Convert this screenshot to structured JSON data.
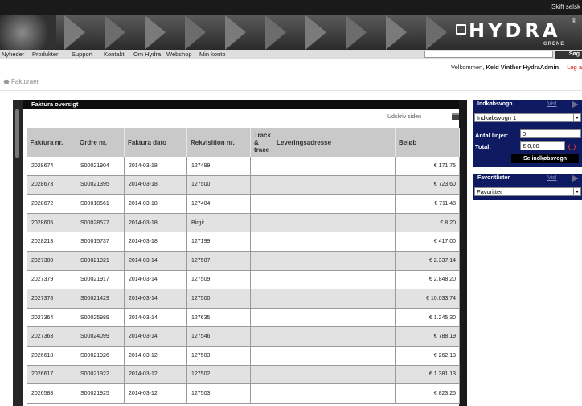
{
  "topbar": {
    "change_company": "Skift selsk"
  },
  "brand": {
    "name": "HYDRA",
    "registered": "®",
    "sub": "GRENE"
  },
  "nav": {
    "items": [
      "Nyheder",
      "Produkter",
      "Support",
      "Kontakt",
      "Om Hydra",
      "Webshop",
      "Min konto"
    ],
    "search_button": "Søg",
    "search_value": ""
  },
  "welcome": {
    "prefix": "Velkommen,",
    "user": "Keld Vinther HydraAdmin",
    "logout": "Log a"
  },
  "breadcrumb": {
    "label": "Fakturaer"
  },
  "invoices": {
    "title": "Faktura oversigt",
    "print_label": "Udskriv siden",
    "columns": [
      "Faktura nr.",
      "Ordre nr.",
      "Faktura dato",
      "Rekvisition nr.",
      "Track & trace",
      "Leveringsadresse",
      "Beløb"
    ],
    "rows": [
      [
        "2028674",
        "S00021904",
        "2014-03-18",
        "127499",
        "",
        "",
        "€ 171,75"
      ],
      [
        "2028673",
        "S00021395",
        "2014-03-18",
        "127500",
        "",
        "",
        "€ 723,60"
      ],
      [
        "2028672",
        "S00018561",
        "2014-03-18",
        "127404",
        "",
        "",
        "€ 711,48"
      ],
      [
        "2028605",
        "S00028577",
        "2014-03-18",
        "Birgit",
        "",
        "",
        "€ 8,20"
      ],
      [
        "2028213",
        "S00015737",
        "2014-03-18",
        "127199",
        "",
        "",
        "€ 417,00"
      ],
      [
        "2027380",
        "S00021921",
        "2014-03-14",
        "127507",
        "",
        "",
        "€ 2.337,14"
      ],
      [
        "2027379",
        "S00021917",
        "2014-03-14",
        "127509",
        "",
        "",
        "€ 2.848,20"
      ],
      [
        "2027378",
        "S00021429",
        "2014-03-14",
        "127500",
        "",
        "",
        "€ 10.033,74"
      ],
      [
        "2027364",
        "S00025989",
        "2014-03-14",
        "127635",
        "",
        "",
        "€ 1.245,30"
      ],
      [
        "2027363",
        "S00024099",
        "2014-03-14",
        "127546",
        "",
        "",
        "€ 788,19"
      ],
      [
        "2026618",
        "S00021926",
        "2014-03-12",
        "127503",
        "",
        "",
        "€ 262,13"
      ],
      [
        "2026617",
        "S00021922",
        "2014-03-12",
        "127502",
        "",
        "",
        "€ 1.381,13"
      ],
      [
        "2026588",
        "S00021925",
        "2014-03-12",
        "127503",
        "",
        "",
        "€ 823,25"
      ]
    ]
  },
  "cart": {
    "title": "Indkøbsvogn",
    "show": "Vis!",
    "selected": "Indkøbsvogn 1",
    "lines_label": "Antal linjer:",
    "lines_value": "0",
    "total_label": "Total:",
    "total_value": "€ 0,00",
    "see_button": "Se indkøbsvogn"
  },
  "favorites": {
    "title": "Favoritlister",
    "show": "Vis!",
    "selected": "Favoritter"
  }
}
